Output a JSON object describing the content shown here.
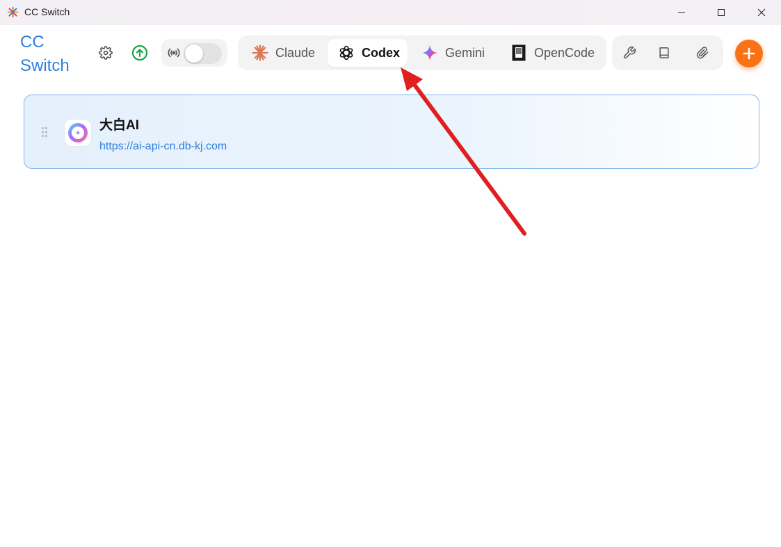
{
  "window": {
    "title": "CC Switch",
    "controls": [
      "minimize-icon",
      "maximize-icon",
      "close-icon"
    ]
  },
  "header": {
    "brand_line1": "CC",
    "brand_line2": "Switch",
    "settings_icon": "gear-icon",
    "update_icon": "arrow-up-circle-icon",
    "proxy_icon": "broadcast-icon",
    "proxy_enabled": false
  },
  "tabs": [
    {
      "label": "Claude",
      "icon": "claude-icon",
      "active": false
    },
    {
      "label": "Codex",
      "icon": "openai-icon",
      "active": true
    },
    {
      "label": "Gemini",
      "icon": "gemini-icon",
      "active": false
    },
    {
      "label": "OpenCode",
      "icon": "opencode-icon",
      "active": false
    }
  ],
  "tools": [
    "wrench-icon",
    "book-icon",
    "paperclip-icon"
  ],
  "add_button_icon": "plus-icon",
  "providers": [
    {
      "name": "大白AI",
      "url": "https://ai-api-cn.db-kj.com",
      "icon": "provider-logo-icon"
    }
  ],
  "colors": {
    "brand": "#2e7fe0",
    "accent": "#f97316",
    "update": "#16a34a",
    "annotation_arrow": "#e02020",
    "card_border": "#7fb6ee"
  }
}
